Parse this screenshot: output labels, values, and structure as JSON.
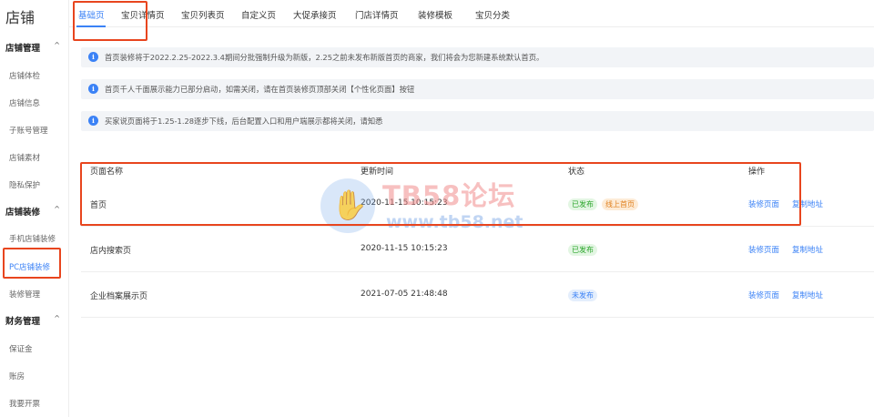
{
  "sidebar": {
    "title": "店铺",
    "groups": [
      {
        "label": "店铺管理",
        "chevron": "^",
        "items": [
          "店铺体检",
          "店铺信息",
          "子账号管理",
          "店铺素材",
          "隐私保护"
        ]
      },
      {
        "label": "店铺装修",
        "chevron": "^",
        "items": [
          "手机店铺装修",
          "PC店铺装修",
          "装修管理"
        ]
      },
      {
        "label": "财务管理",
        "chevron": "^",
        "items": [
          "保证金",
          "账房",
          "我要开票"
        ]
      }
    ],
    "active_item": "PC店铺装修"
  },
  "tabs": [
    "基础页",
    "宝贝详情页",
    "宝贝列表页",
    "自定义页",
    "大促承接页",
    "门店详情页",
    "装修模板",
    "宝贝分类"
  ],
  "active_tab": "基础页",
  "notices": [
    "首页装修将于2022.2.25-2022.3.4期间分批强制升级为新版，2.25之前未发布新版首页的商家，我们将会为您新建系统默认首页。",
    "首页千人千面展示能力已部分启动，如需关闭，请在首页装修页顶部关闭【个性化页面】按钮",
    "买家说页面将于1.25-1.28逐步下线，后台配置入口和用户端展示都将关闭，请知悉"
  ],
  "info_icon": "i",
  "table": {
    "headers": {
      "name": "页面名称",
      "time": "更新时间",
      "status": "状态",
      "ops": "操作"
    },
    "rows": [
      {
        "name": "首页",
        "time": "2020-11-15 10:15:23",
        "status": "已发布",
        "extra_status": "线上首页",
        "op1": "装修页面",
        "op2": "复制地址"
      },
      {
        "name": "店内搜索页",
        "time": "2020-11-15 10:15:23",
        "status": "已发布",
        "op1": "装修页面",
        "op2": "复制地址"
      },
      {
        "name": "企业档案展示页",
        "time": "2021-07-05 21:48:48",
        "status": "未发布",
        "op1": "装修页面",
        "op2": "复制地址"
      }
    ]
  },
  "watermark": {
    "line1": "TB58论坛",
    "line2": "www.tb58.net",
    "icon": "hand-icon"
  },
  "colors": {
    "accent": "#3b82f6",
    "highlight": "#e8451e",
    "published": "#2aa52a",
    "online": "#e0801e"
  }
}
